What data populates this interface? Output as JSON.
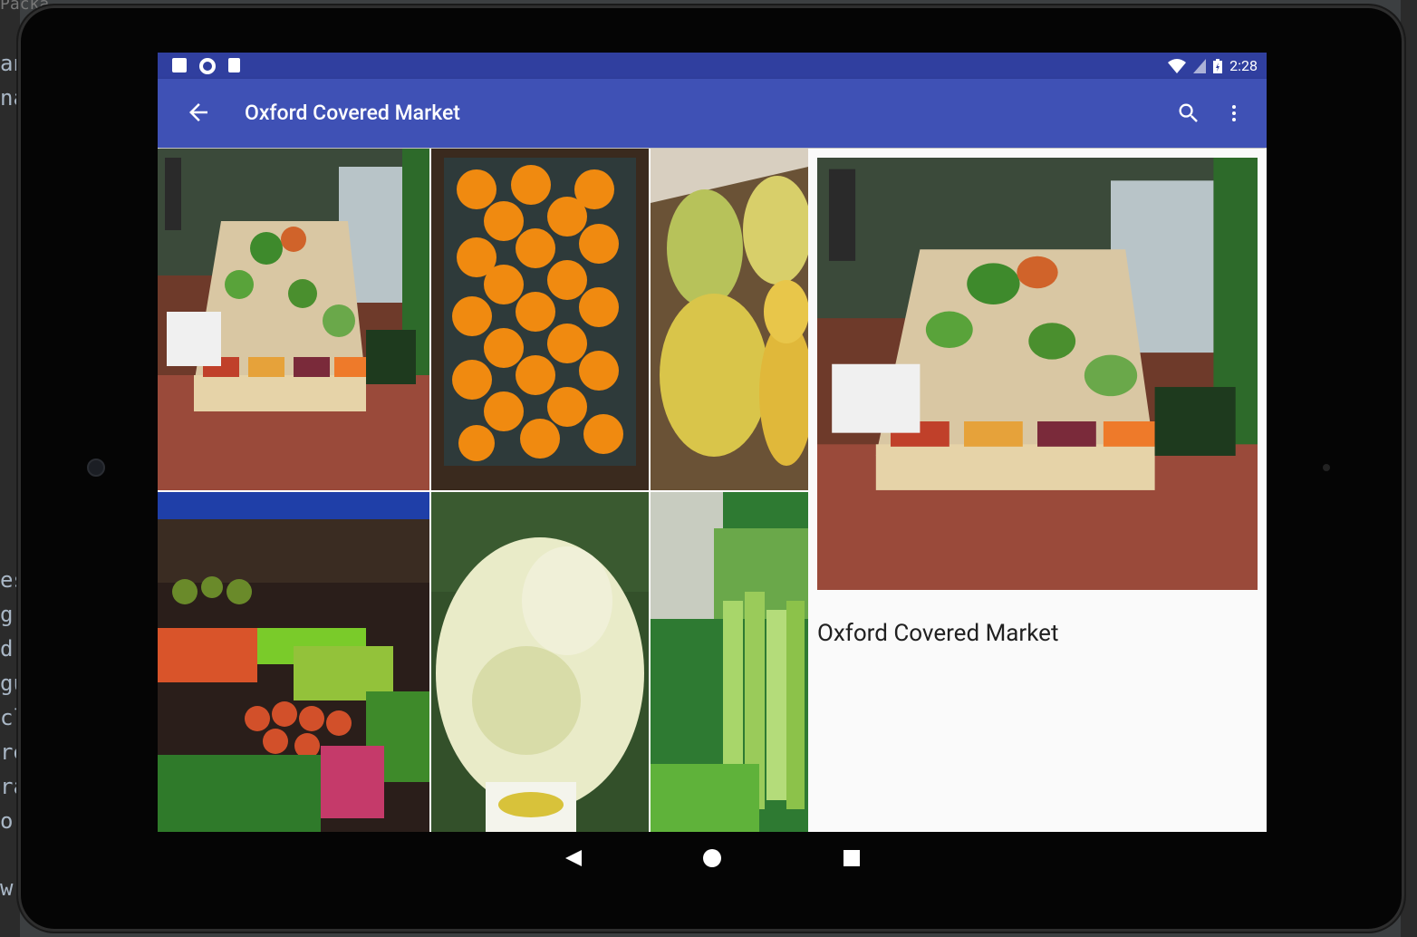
{
  "status_bar": {
    "time": "2:28"
  },
  "toolbar": {
    "title": "Oxford Covered Market",
    "back_icon": "arrow-back-icon",
    "search_icon": "search-icon",
    "more_icon": "more-vert-icon"
  },
  "gallery": {
    "images": [
      {
        "subject": "market vegetable stall"
      },
      {
        "subject": "crate of oranges"
      },
      {
        "subject": "lemons in box"
      },
      {
        "subject": "vegetable market under tarp"
      },
      {
        "subject": "radicchio lettuce"
      },
      {
        "subject": "celery"
      }
    ]
  },
  "detail": {
    "title": "Oxford Covered Market"
  },
  "nav_bar": {
    "back": "nav-back-icon",
    "home": "nav-home-icon",
    "recents": "nav-recents-icon"
  },
  "ide_fragments": [
    "an",
    "na",
    "es",
    "gr",
    "d.",
    "gu",
    "cl",
    "re",
    "ra",
    "or",
    "w.b",
    "Packa"
  ],
  "colors": {
    "primary": "#3f51b5",
    "primary_dark": "#303f9f"
  }
}
